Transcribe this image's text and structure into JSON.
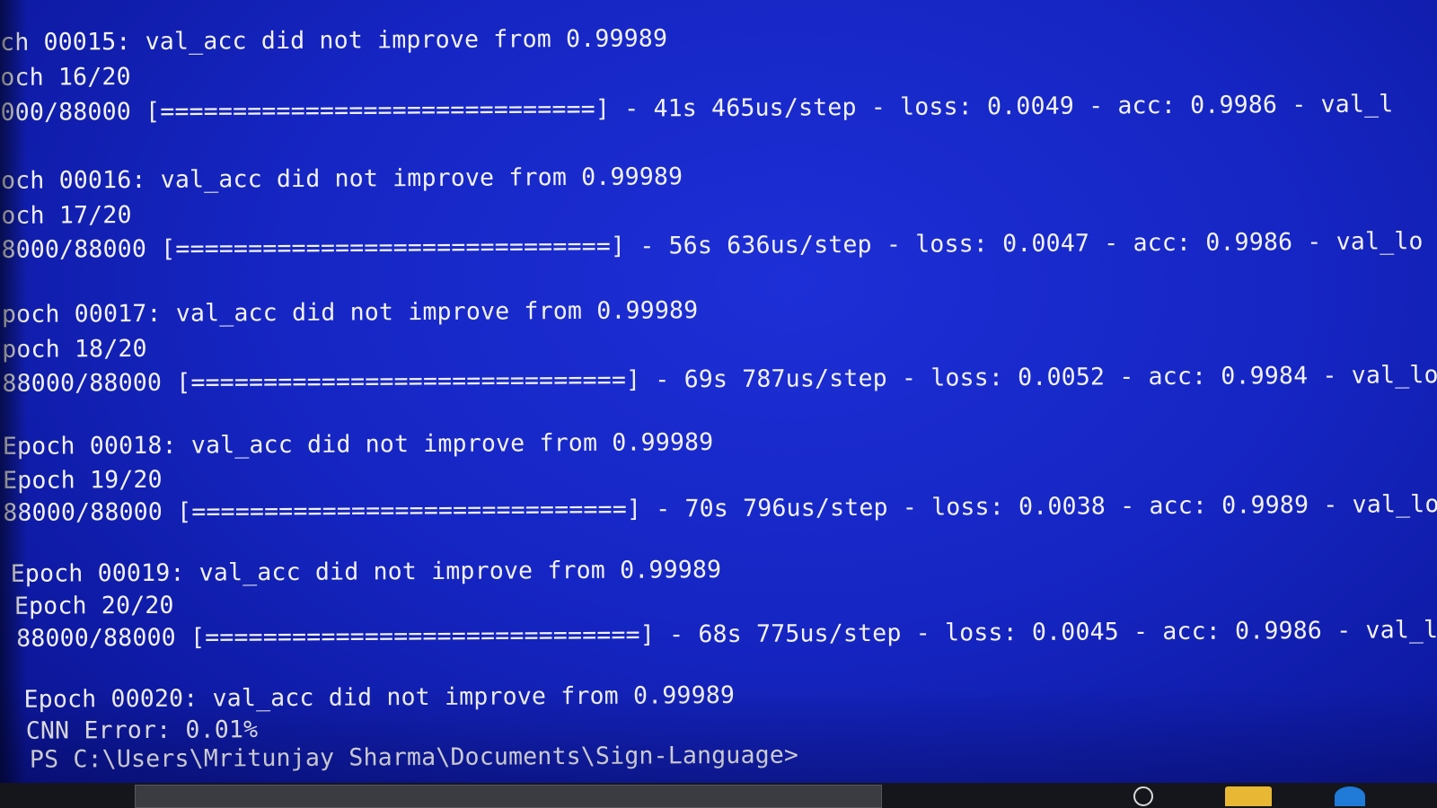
{
  "terminal": {
    "lines": [
      "ch 00015: val_acc did not improve from 0.99989",
      "och 16/20",
      "000/88000 [==============================] - 41s 465us/step - loss: 0.0049 - acc: 0.9986 - val_l",
      "och 00016: val_acc did not improve from 0.99989",
      "och 17/20",
      "8000/88000 [==============================] - 56s 636us/step - loss: 0.0047 - acc: 0.9986 - val_lo",
      "poch 00017: val_acc did not improve from 0.99989",
      "poch 18/20",
      "88000/88000 [==============================] - 69s 787us/step - loss: 0.0052 - acc: 0.9984 - val_los",
      "Epoch 00018: val_acc did not improve from 0.99989",
      "Epoch 19/20",
      "88000/88000 [==============================] - 70s 796us/step - loss: 0.0038 - acc: 0.9989 - val_loss",
      "Epoch 00019: val_acc did not improve from 0.99989",
      "Epoch 20/20",
      "88000/88000 [==============================] - 68s 775us/step - loss: 0.0045 - acc: 0.9986 - val_loss",
      "Epoch 00020: val_acc did not improve from 0.99989",
      "CNN Error: 0.01%",
      "PS C:\\Users\\Mritunjay Sharma\\Documents\\Sign-Language>"
    ]
  },
  "taskbar": {
    "icons": [
      "task-view-icon",
      "file-explorer-icon",
      "edge-browser-icon"
    ]
  },
  "colors": {
    "background": "#1626c4",
    "text": "#f2f2f2"
  }
}
